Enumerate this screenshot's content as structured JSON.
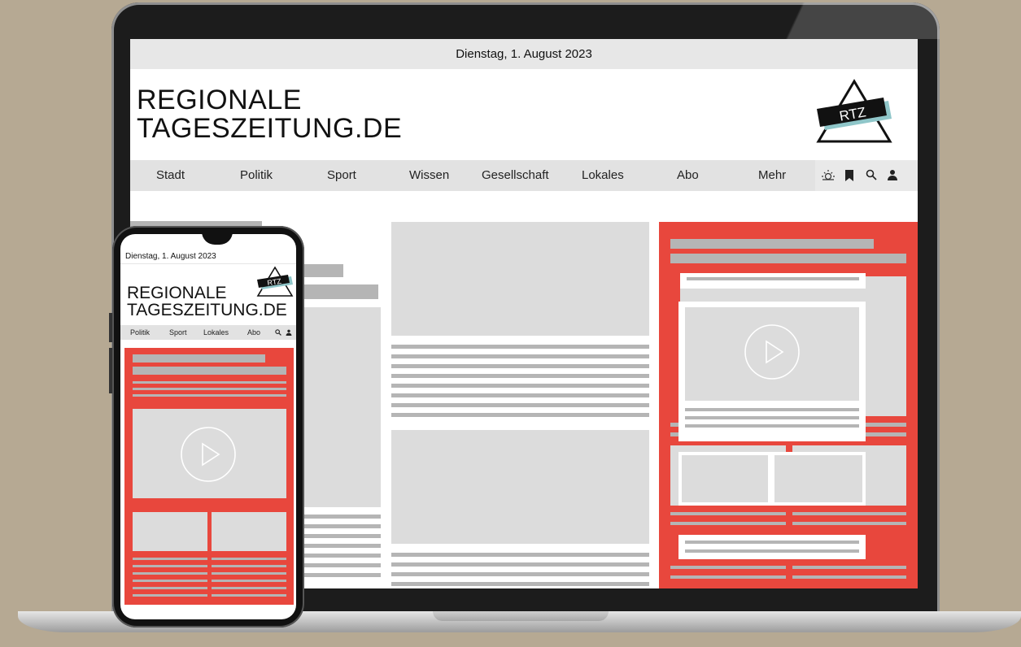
{
  "laptop": {
    "date": "Dienstag, 1. August 2023",
    "brand": {
      "line1": "REGIONALE",
      "line2": "TAGESZEITUNG.DE",
      "logo_text": "RTZ"
    },
    "nav": [
      "Stadt",
      "Politik",
      "Sport",
      "Wissen",
      "Gesellschaft",
      "Lokales",
      "Abo",
      "Mehr"
    ],
    "nav_icons": [
      "weather-icon",
      "bookmark-icon",
      "search-icon",
      "user-icon"
    ]
  },
  "phone": {
    "date": "Dienstag, 1. August 2023",
    "brand": {
      "line1": "REGIONALE",
      "line2": "TAGESZEITUNG.DE",
      "logo_text": "RTZ"
    },
    "nav": [
      "Politik",
      "Sport",
      "Lokales",
      "Abo"
    ],
    "nav_icons": [
      "search-icon",
      "user-icon"
    ]
  },
  "colors": {
    "accent": "#e8473d",
    "background": "#b6a993",
    "placeholder": "#dcdcdc"
  }
}
